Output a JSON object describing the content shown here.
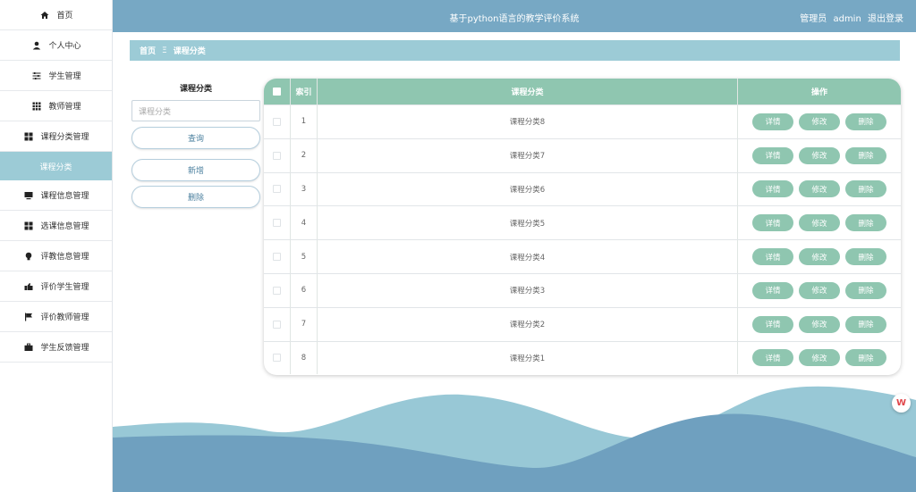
{
  "app": {
    "title": "基于python语言的教学评价系统"
  },
  "header": {
    "role": "管理员",
    "username": "admin",
    "logout": "退出登录"
  },
  "sidebar": {
    "items": [
      {
        "label": "首页",
        "icon": "home-icon"
      },
      {
        "label": "个人中心",
        "icon": "user-icon"
      },
      {
        "label": "学生管理",
        "icon": "sliders-icon"
      },
      {
        "label": "教师管理",
        "icon": "grid-icon"
      },
      {
        "label": "课程分类管理",
        "icon": "apps-icon"
      },
      {
        "label": "课程分类",
        "icon": ""
      },
      {
        "label": "课程信息管理",
        "icon": "monitor-icon"
      },
      {
        "label": "选课信息管理",
        "icon": "apps-icon"
      },
      {
        "label": "评教信息管理",
        "icon": "bulb-icon"
      },
      {
        "label": "评价学生管理",
        "icon": "hand-icon"
      },
      {
        "label": "评价教师管理",
        "icon": "flag-icon"
      },
      {
        "label": "学生反馈管理",
        "icon": "briefcase-icon"
      }
    ]
  },
  "breadcrumb": {
    "home": "首页",
    "separator": "Ξ",
    "current": "课程分类"
  },
  "search": {
    "label": "课程分类",
    "placeholder": "课程分类",
    "query_button": "查询",
    "add_button": "新增",
    "delete_button": "删除"
  },
  "table": {
    "headers": {
      "index": "索引",
      "name": "课程分类",
      "ops": "操作"
    },
    "op_labels": {
      "detail": "详情",
      "edit": "修改",
      "delete": "删除"
    },
    "rows": [
      {
        "index": "1",
        "name": "课程分类8"
      },
      {
        "index": "2",
        "name": "课程分类7"
      },
      {
        "index": "3",
        "name": "课程分类6"
      },
      {
        "index": "4",
        "name": "课程分类5"
      },
      {
        "index": "5",
        "name": "课程分类4"
      },
      {
        "index": "6",
        "name": "课程分类3"
      },
      {
        "index": "7",
        "name": "课程分类2"
      },
      {
        "index": "8",
        "name": "课程分类1"
      }
    ]
  },
  "colors": {
    "topbar": "#77a8c4",
    "accent_light": "#9ccbd6",
    "table_header": "#8fc6b0",
    "wave_light": "#98c8d6",
    "wave_dark": "#6fa0bf"
  }
}
